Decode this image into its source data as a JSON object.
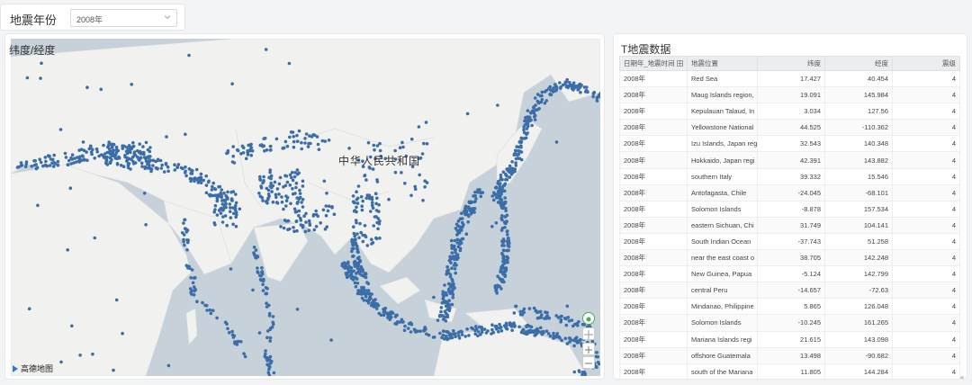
{
  "filter": {
    "label": "地震年份",
    "value": "2008年"
  },
  "map": {
    "title": "纬度/经度",
    "country_label": "中华人民共和国",
    "logo_text": "高德地图",
    "dot_color": "#3b6ea8"
  },
  "table": {
    "title": "T地震数据",
    "columns": [
      "日期年_地震时间 田",
      "地震位置",
      "纬度",
      "经度",
      "震级"
    ],
    "rows": [
      [
        "2008年",
        "Red Sea",
        "17.427",
        "40.454",
        "4"
      ],
      [
        "2008年",
        "Maug Islands region,",
        "19.091",
        "145.984",
        "4"
      ],
      [
        "2008年",
        "Kepulauan Talaud, In",
        "3.034",
        "127.56",
        "4"
      ],
      [
        "2008年",
        "Yellowstone National",
        "44.525",
        "-110.362",
        "4"
      ],
      [
        "2008年",
        "Izu Islands, Japan reg",
        "32.543",
        "140.348",
        "4"
      ],
      [
        "2008年",
        "Hokkaido, Japan regi",
        "42.391",
        "143.882",
        "4"
      ],
      [
        "2008年",
        "southern Italy",
        "39.332",
        "15.546",
        "4"
      ],
      [
        "2008年",
        "Antofagasta, Chile",
        "-24.045",
        "-68.101",
        "4"
      ],
      [
        "2008年",
        "Solomon Islands",
        "-8.878",
        "157.534",
        "4"
      ],
      [
        "2008年",
        "eastern Sichuan, Chi",
        "31.749",
        "104.141",
        "4"
      ],
      [
        "2008年",
        "South Indian Ocean",
        "-37.743",
        "51.258",
        "4"
      ],
      [
        "2008年",
        "near the east coast o",
        "38.705",
        "142.248",
        "4"
      ],
      [
        "2008年",
        "New Guinea, Papua",
        "-5.124",
        "142.799",
        "4"
      ],
      [
        "2008年",
        "central Peru",
        "-14.657",
        "-72.63",
        "4"
      ],
      [
        "2008年",
        "Mindanao, Philippine",
        "5.865",
        "126.048",
        "4"
      ],
      [
        "2008年",
        "Solomon Islands",
        "-10.245",
        "161.265",
        "4"
      ],
      [
        "2008年",
        "Mariana Islands regi",
        "21.615",
        "143.098",
        "4"
      ],
      [
        "2008年",
        "offshore Guatemala",
        "13.498",
        "-90.682",
        "4"
      ],
      [
        "2008年",
        "south of the Mariana",
        "11.805",
        "144.284",
        "4"
      ]
    ]
  }
}
